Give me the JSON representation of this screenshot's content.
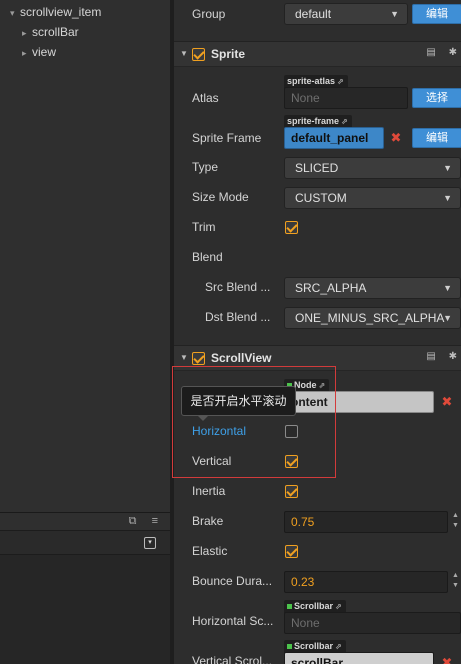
{
  "hierarchy": {
    "items": [
      {
        "label": "scrollview_item",
        "arrow": "▾",
        "depth": 0
      },
      {
        "label": "scrollBar",
        "arrow": "▸",
        "depth": 1
      },
      {
        "label": "view",
        "arrow": "▸",
        "depth": 1
      }
    ],
    "lower_panel": {
      "tab_icons": "⧉ ≡",
      "dropdown_icon": "▾"
    }
  },
  "inspector": {
    "group": {
      "label": "Group",
      "value": "default",
      "button": "编辑"
    },
    "sprite": {
      "title": "Sprite",
      "atlas": {
        "label": "Atlas",
        "tag": "sprite-atlas",
        "value": "None",
        "button": "选择"
      },
      "sprite_frame": {
        "label": "Sprite Frame",
        "tag": "sprite-frame",
        "value": "default_panel",
        "button": "编辑",
        "clear": "✖"
      },
      "type": {
        "label": "Type",
        "value": "SLICED"
      },
      "size_mode": {
        "label": "Size Mode",
        "value": "CUSTOM"
      },
      "trim": {
        "label": "Trim",
        "checked": true
      },
      "blend": {
        "label": "Blend"
      },
      "src_blend": {
        "label": "Src Blend ...",
        "value": "SRC_ALPHA"
      },
      "dst_blend": {
        "label": "Dst Blend ...",
        "value": "ONE_MINUS_SRC_ALPHA"
      }
    },
    "scrollview": {
      "title": "ScrollView",
      "content": {
        "tag": "Node",
        "value": "ontent",
        "clear": "✖"
      },
      "horizontal": {
        "label": "Horizontal",
        "checked": false
      },
      "vertical": {
        "label": "Vertical",
        "checked": true
      },
      "inertia": {
        "label": "Inertia",
        "checked": true
      },
      "brake": {
        "label": "Brake",
        "value": "0.75"
      },
      "elastic": {
        "label": "Elastic",
        "checked": true
      },
      "bounce_duration": {
        "label": "Bounce Dura...",
        "value": "0.23"
      },
      "horizontal_scrollbar": {
        "label": "Horizontal Sc...",
        "tag": "Scrollbar",
        "value": "None"
      },
      "vertical_scrollbar": {
        "label": "Vertical Scrol...",
        "tag": "Scrollbar",
        "value": "scrollBar",
        "clear": "✖"
      }
    },
    "section_icons": {
      "book": "▤",
      "gear": "✱"
    }
  },
  "tooltip": {
    "text": "是否开启水平滚动"
  },
  "colors": {
    "accent": "#3f8fd6",
    "checkbox": "#f0a020",
    "highlight_border": "#d23b3b",
    "tooltip_label": "#3ea0e8"
  }
}
